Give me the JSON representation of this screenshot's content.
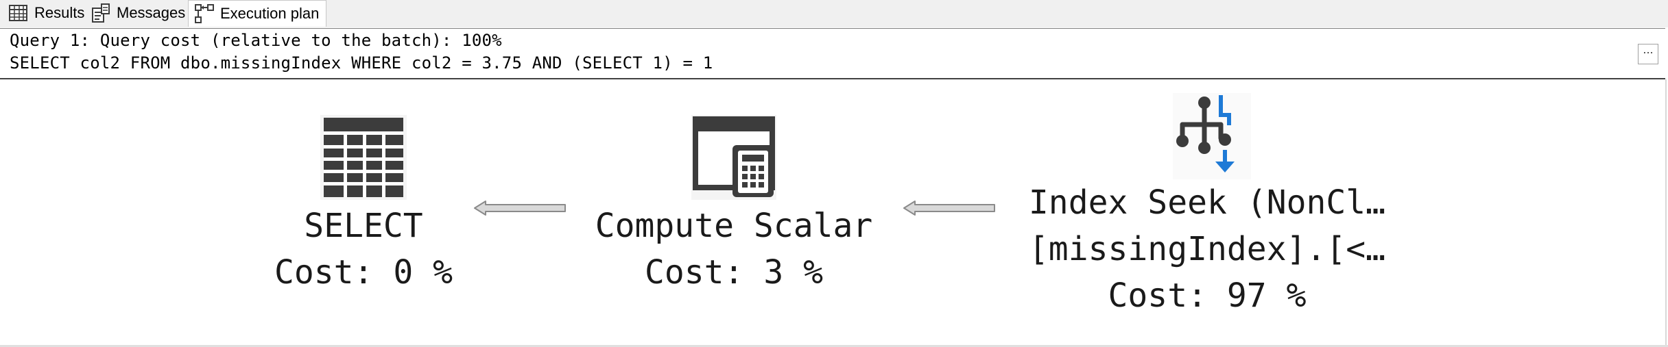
{
  "tabs": [
    {
      "label": "Results",
      "icon": "grid-icon",
      "active": false
    },
    {
      "label": "Messages",
      "icon": "messages-icon",
      "active": false
    },
    {
      "label": "Execution plan",
      "icon": "execution-plan-icon",
      "active": true
    }
  ],
  "query": {
    "cost_line": "Query 1: Query cost (relative to the batch): 100%",
    "sql_line": "SELECT col2 FROM dbo.missingIndex WHERE col2 = 3.75 AND (SELECT 1) = 1",
    "more_button": "..."
  },
  "plan": {
    "nodes": [
      {
        "id": "select",
        "icon": "select-table-icon",
        "line1": "SELECT",
        "line2": "Cost: 0 %"
      },
      {
        "id": "compute-scalar",
        "icon": "calculator-icon",
        "line1": "Compute Scalar",
        "line2": "Cost: 3 %"
      },
      {
        "id": "index-seek",
        "icon": "index-seek-icon",
        "line1": "Index Seek (NonCl…",
        "line2": "[missingIndex].[<…",
        "line3": "Cost: 97 %"
      }
    ]
  },
  "colors": {
    "icon_dark": "#3c3c3c",
    "seek_accent": "#1e7ad6",
    "arrow_fill": "#d9d9d9",
    "arrow_stroke": "#8a8a8a"
  }
}
